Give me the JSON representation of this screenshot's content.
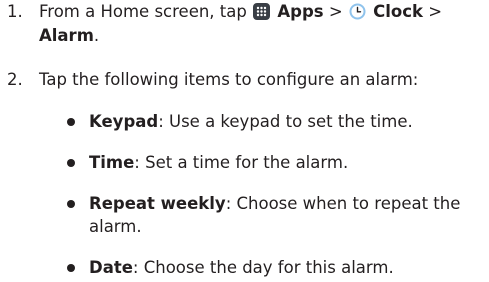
{
  "steps": [
    {
      "number": "1.",
      "intro": "From a Home screen, tap",
      "apps_label": "Apps",
      "sep1": ">",
      "clock_label": "Clock",
      "sep2": ">",
      "alarm_label": "Alarm",
      "end": "."
    },
    {
      "number": "2.",
      "text": "Tap the following items to configure an alarm:"
    }
  ],
  "bullets": [
    {
      "term": "Keypad",
      "desc": ": Use a keypad to set the time."
    },
    {
      "term": "Time",
      "desc": ": Set a time for the alarm."
    },
    {
      "term": "Repeat weekly",
      "desc": ": Choose when to repeat the",
      "desc_cont": "alarm."
    },
    {
      "term": "Date",
      "desc": ": Choose the day for this alarm."
    }
  ],
  "icons": {
    "apps": "apps-grid-icon",
    "clock": "clock-icon",
    "apps_color": "#3a3f46",
    "clock_color": "#8fc3ec"
  }
}
